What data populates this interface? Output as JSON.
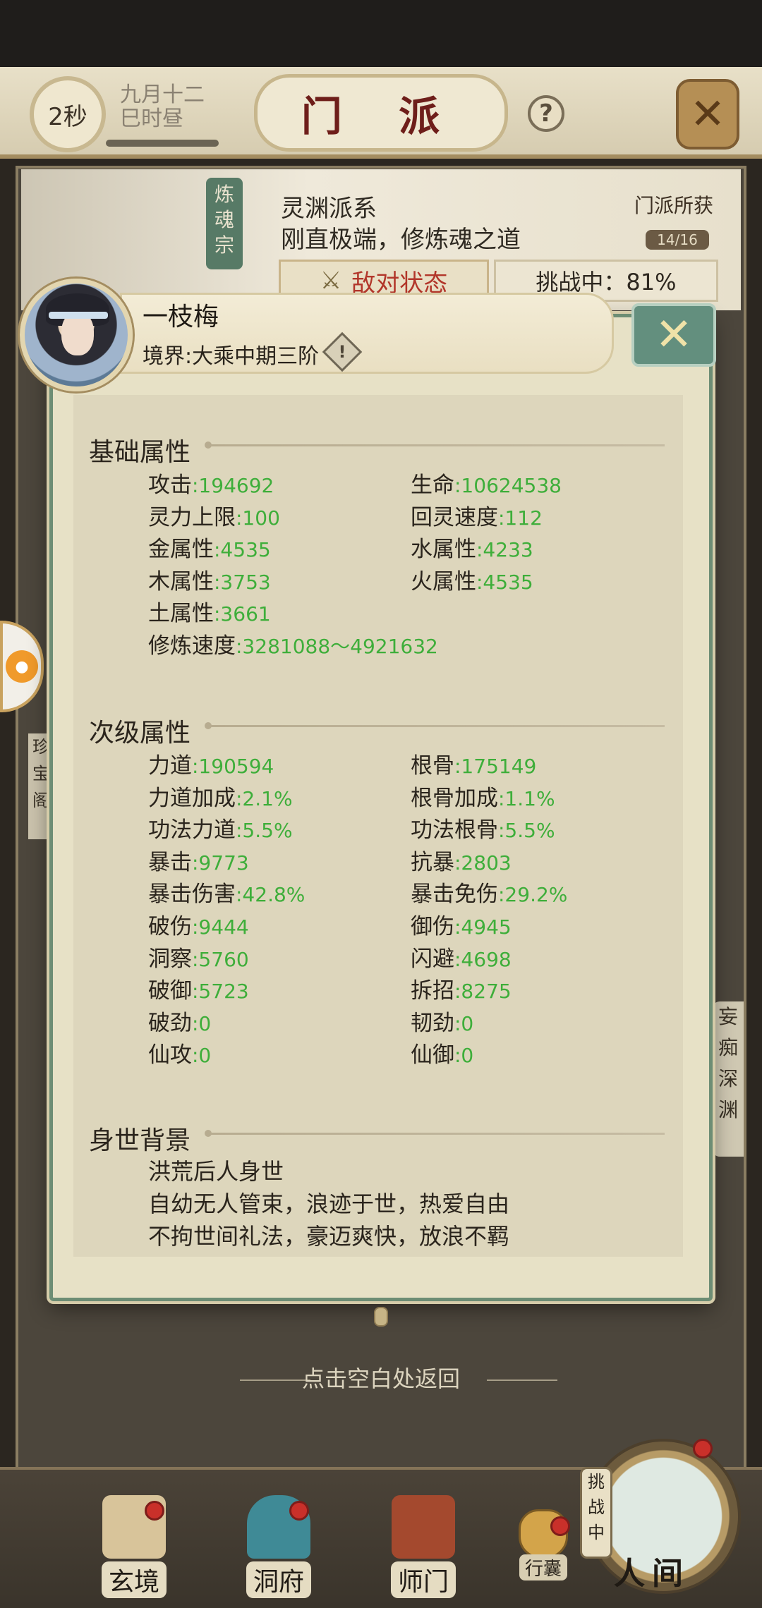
{
  "header": {
    "timer": "2秒",
    "date_line1": "九月十二",
    "date_line2": "巳时昼",
    "title": "门 派",
    "help_icon": "?"
  },
  "sect": {
    "vertical_name": "炼魂宗",
    "line1": "灵渊派系",
    "line2": "刚直极端，修炼魂之道",
    "gain_label": "门派所获",
    "gain_count": "14/16",
    "enemy_label": "敌对状态",
    "challenge_label": "挑战中：81%",
    "left_strip": "珍宝阁",
    "right_strip": "妄痴深渊"
  },
  "character": {
    "name": "一枝梅",
    "realm": "境界:大乘中期三阶",
    "realm_icon": "!"
  },
  "basic": {
    "title": "基础属性",
    "stats": [
      {
        "label": "攻击",
        "value": ":194692"
      },
      {
        "label": "生命",
        "value": ":10624538"
      },
      {
        "label": "灵力上限",
        "value": ":100"
      },
      {
        "label": "回灵速度",
        "value": ":112"
      },
      {
        "label": "金属性",
        "value": ":4535"
      },
      {
        "label": "水属性",
        "value": ":4233"
      },
      {
        "label": "木属性",
        "value": ":3753"
      },
      {
        "label": "火属性",
        "value": ":4535"
      },
      {
        "label": "土属性",
        "value": ":3661"
      },
      {
        "label": "修炼速度",
        "value": ":3281088～4921632"
      }
    ]
  },
  "secondary": {
    "title": "次级属性",
    "stats": [
      {
        "label": "力道",
        "value": ":190594"
      },
      {
        "label": "根骨",
        "value": ":175149"
      },
      {
        "label": "力道加成",
        "value": ":2.1%"
      },
      {
        "label": "根骨加成",
        "value": ":1.1%"
      },
      {
        "label": "功法力道",
        "value": ":5.5%"
      },
      {
        "label": "功法根骨",
        "value": ":5.5%"
      },
      {
        "label": "暴击",
        "value": ":9773"
      },
      {
        "label": "抗暴",
        "value": ":2803"
      },
      {
        "label": "暴击伤害",
        "value": ":42.8%"
      },
      {
        "label": "暴击免伤",
        "value": ":29.2%"
      },
      {
        "label": "破伤",
        "value": ":9444"
      },
      {
        "label": "御伤",
        "value": ":4945"
      },
      {
        "label": "洞察",
        "value": ":5760"
      },
      {
        "label": "闪避",
        "value": ":4698"
      },
      {
        "label": "破御",
        "value": ":5723"
      },
      {
        "label": "拆招",
        "value": ":8275"
      },
      {
        "label": "破劲",
        "value": ":0"
      },
      {
        "label": "韧劲",
        "value": ":0"
      },
      {
        "label": "仙攻",
        "value": ":0"
      },
      {
        "label": "仙御",
        "value": ":0"
      }
    ]
  },
  "background": {
    "title": "身世背景",
    "lines": [
      "洪荒后人身世",
      "自幼无人管束，浪迹于世，热爱自由",
      "不拘世间礼法，豪迈爽快，放浪不羁"
    ]
  },
  "return_hint": "点击空白处返回",
  "nav": {
    "items": [
      {
        "label": "玄境"
      },
      {
        "label": "洞府"
      },
      {
        "label": "师门"
      }
    ],
    "pack_label": "行囊",
    "challenging_label": "挑战中",
    "world_label": "人间"
  },
  "colors": {
    "stat_value": "#3eae3a",
    "popup_border": "#6d8d74",
    "title_red": "#6e1e1a",
    "notification_dot": "#c9302a"
  },
  "icons": {
    "popup_close": "close-icon",
    "header_close": "crossed-swords-close-icon",
    "help": "question-icon",
    "realm": "diamond-exclamation-icon",
    "enemy": "crossed-swords-icon"
  }
}
